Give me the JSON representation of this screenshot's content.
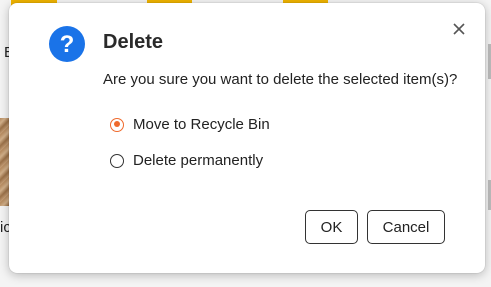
{
  "dialog": {
    "title": "Delete",
    "message": "Are you sure you want to delete the selected item(s)?",
    "options": [
      {
        "label": "Move to Recycle Bin",
        "selected": true
      },
      {
        "label": "Delete permanently",
        "selected": false
      }
    ],
    "ok_label": "OK",
    "cancel_label": "Cancel",
    "icons": {
      "title_icon": "question-icon",
      "close_icon": "close-icon"
    }
  },
  "background": {
    "left_text_top": "E",
    "left_text_bottom": "ic"
  },
  "colors": {
    "accent": "#ef6a2d",
    "icon_blue": "#1a73e8",
    "highlight_bar": "#f0b400"
  }
}
